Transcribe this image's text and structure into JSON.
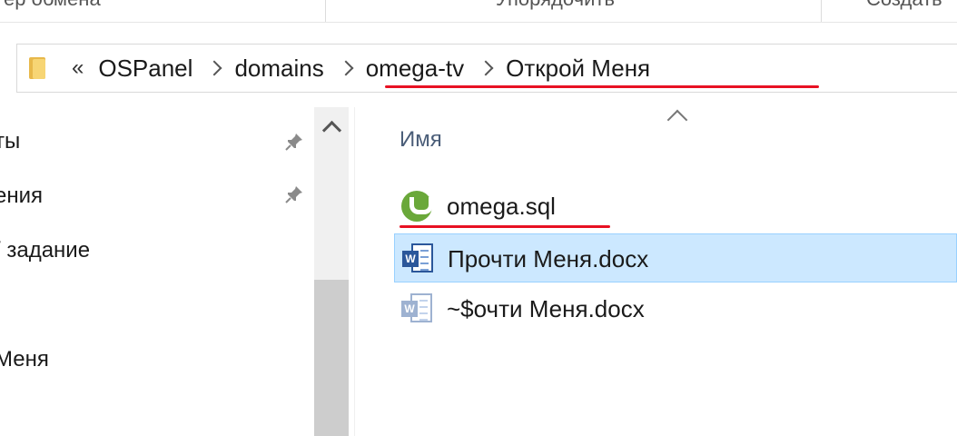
{
  "ribbon": {
    "left_group_label": "ер обмена",
    "middle_group_label": "Упорядочить",
    "right_group_label": "Создать"
  },
  "address": {
    "overflow_label": "«",
    "crumbs": [
      "OSPanel",
      "domains",
      "omega-tv",
      "Открой Меня"
    ]
  },
  "nav": {
    "items": [
      "ты",
      "ения",
      "/ задание",
      "Меня"
    ]
  },
  "file_list": {
    "column_name": "Имя",
    "files": [
      {
        "name": "omega.sql",
        "icon": "utorrent-icon"
      },
      {
        "name": "Прочти Меня.docx",
        "icon": "word-document-icon",
        "selected": true
      },
      {
        "name": "~$очти Меня.docx",
        "icon": "word-document-temp-icon"
      }
    ]
  },
  "colors": {
    "selection_bg": "#cce8ff",
    "annotation_red": "#e81123",
    "word_blue": "#2b579a",
    "utorrent_green": "#6aa83a"
  }
}
